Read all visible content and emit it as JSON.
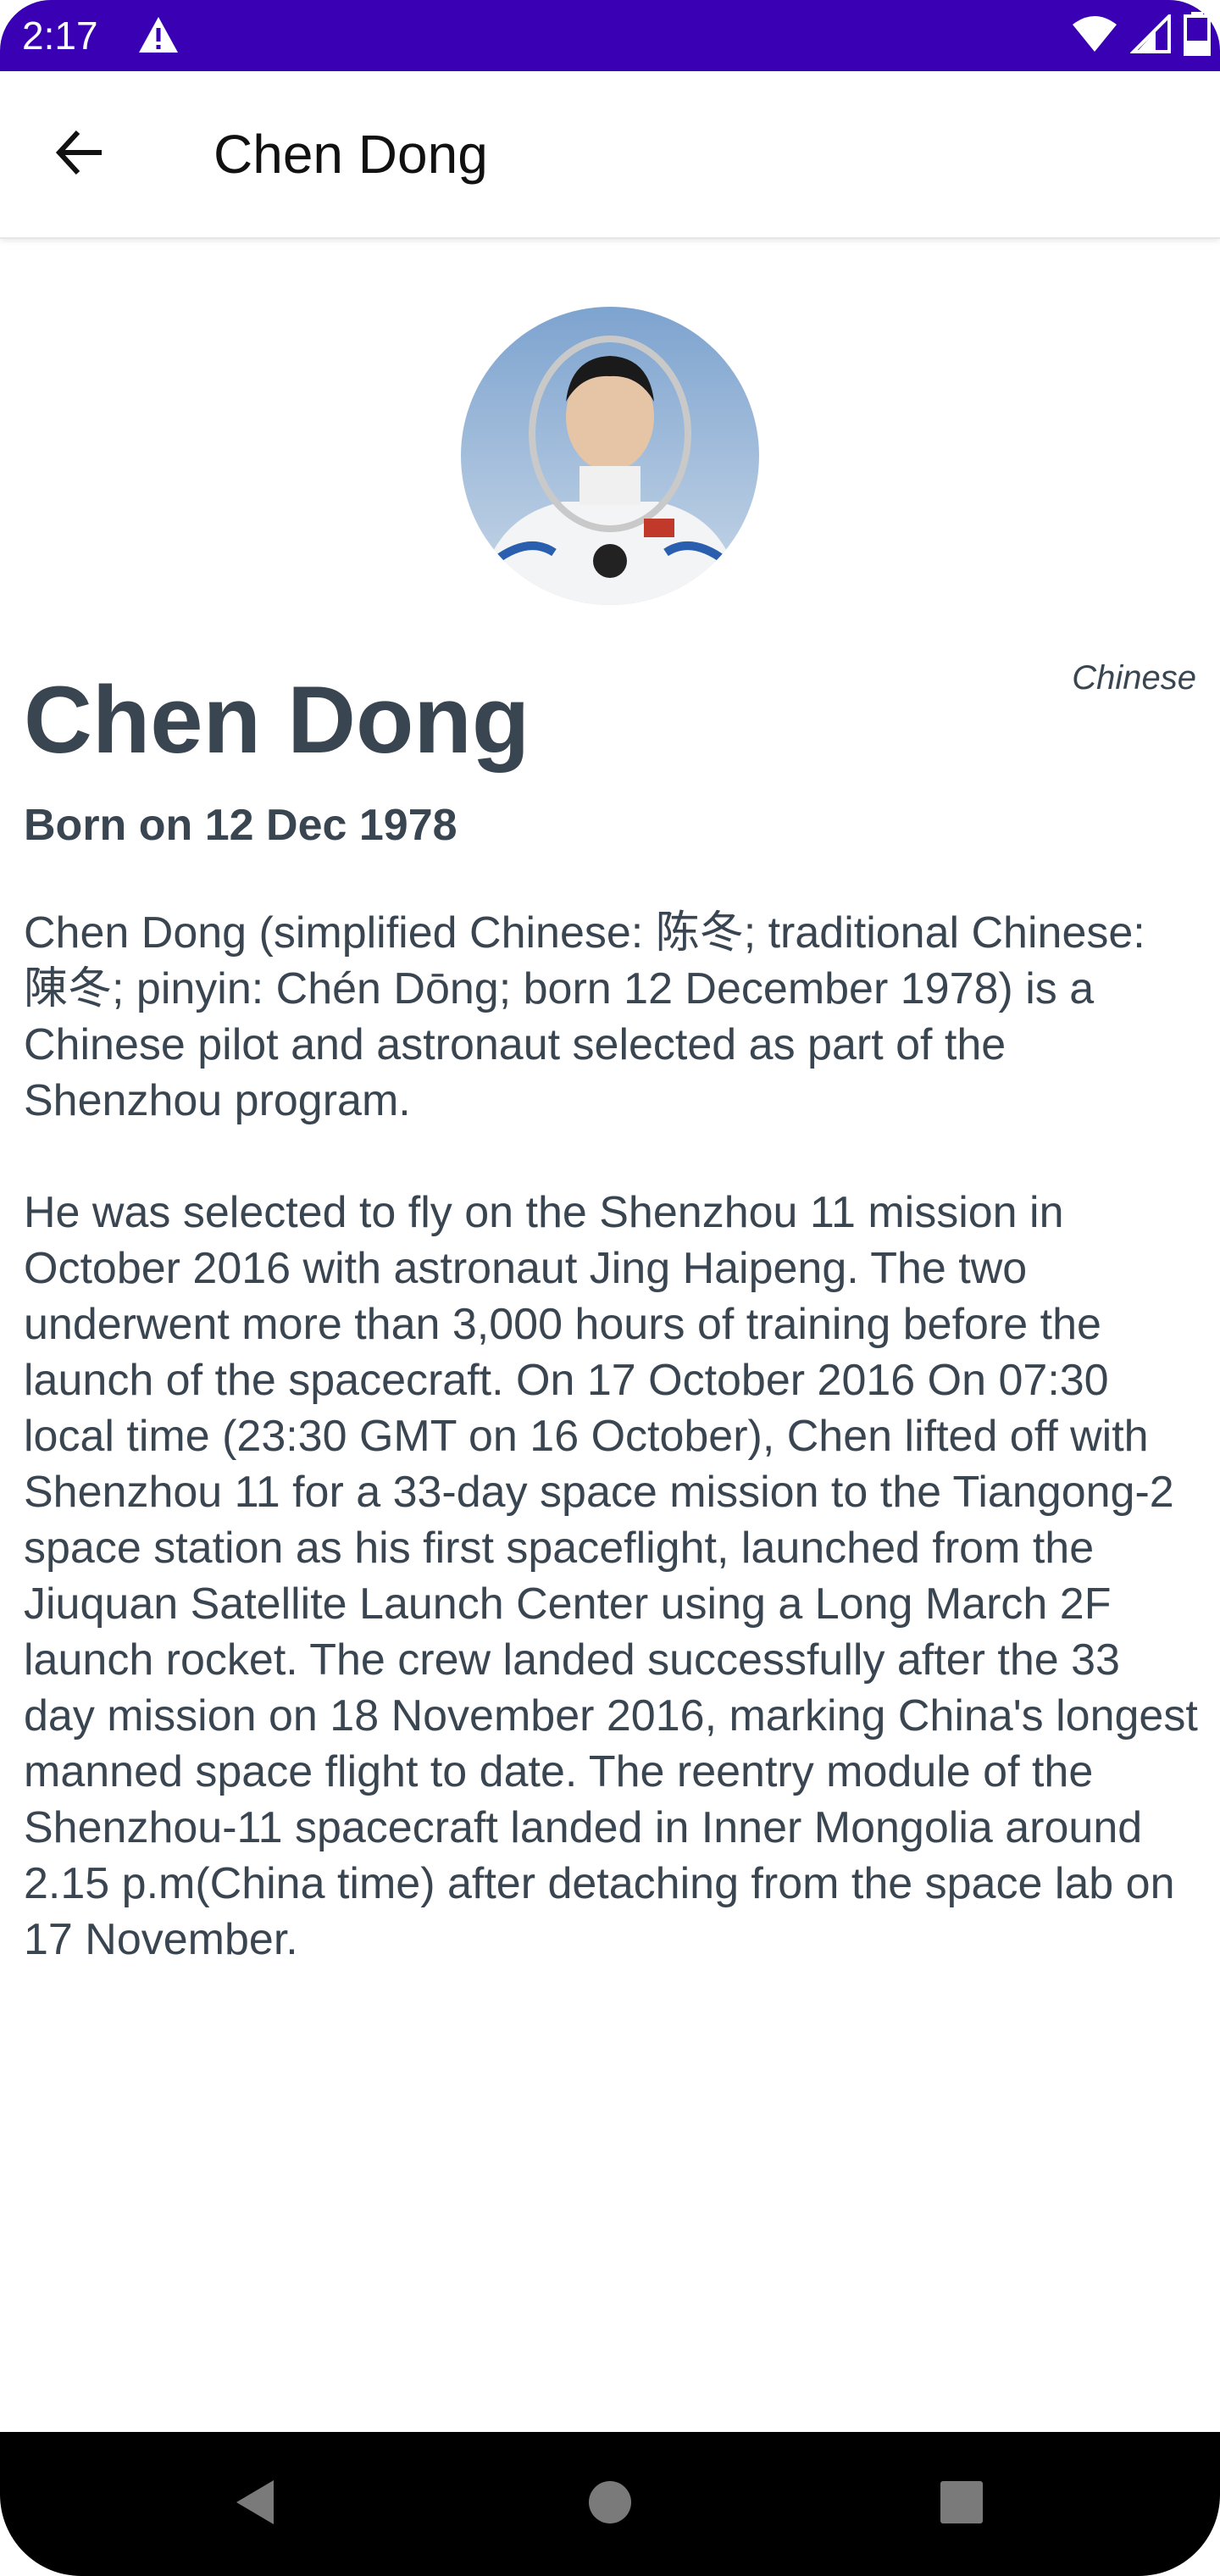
{
  "status_bar": {
    "time": "2:17",
    "background_color": "#3a00b3",
    "icons": [
      "warning-icon",
      "wifi-icon",
      "signal-icon",
      "battery-icon"
    ]
  },
  "app_bar": {
    "title": "Chen Dong",
    "back_icon": "arrow-back-icon"
  },
  "profile": {
    "name": "Chen Dong",
    "nationality": "Chinese",
    "born": "Born on 12 Dec 1978",
    "bio_paragraphs": [
      "Chen Dong (simplified Chinese: 陈冬; traditional Chinese: 陳冬; pinyin: Chén Dōng; born 12 December 1978) is a Chinese pilot and astronaut selected as part of the Shenzhou program.",
      "He was selected to fly on the Shenzhou 11 mission in October 2016 with astronaut Jing Haipeng. The two underwent more than 3,000 hours of training before the launch of the spacecraft. On 17 October 2016 On 07:30 local time (23:30 GMT on 16 October), Chen lifted off with Shenzhou 11 for a 33-day space mission to the Tiangong-2 space station as his first spaceflight, launched from the Jiuquan Satellite Launch Center using a Long March 2F launch rocket. The crew landed successfully after the 33 day mission on 18 November 2016, marking China's longest manned space flight to date. The reentry module of the Shenzhou-11 spacecraft landed in Inner Mongolia around 2.15 p.m(China time) after detaching from the space lab on 17 November."
    ],
    "text_color": "#394550"
  },
  "nav_bar": {
    "icons": [
      "back-triangle-icon",
      "home-circle-icon",
      "recents-square-icon"
    ]
  }
}
